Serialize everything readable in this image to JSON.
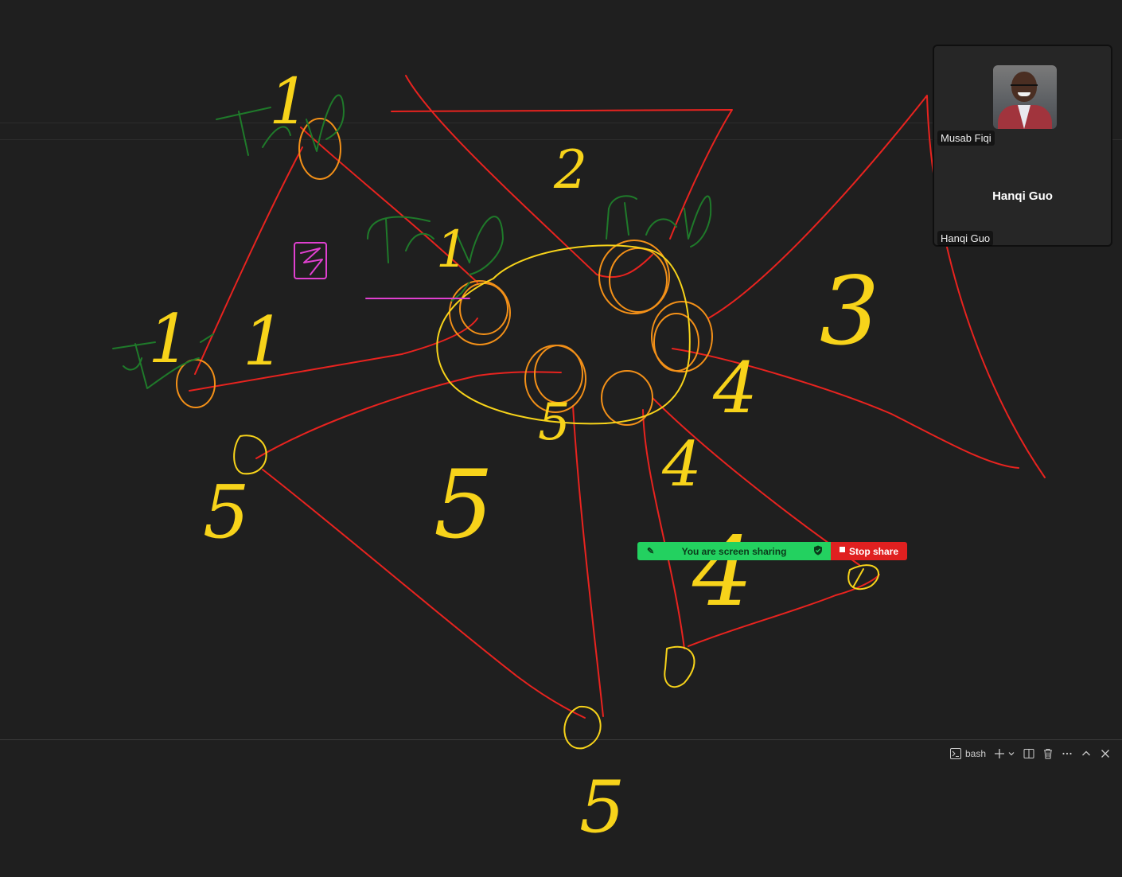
{
  "participants": {
    "video_tile": {
      "name": "Musab Fiqi"
    },
    "audio_tile": {
      "display_name": "Hanqi Guo",
      "name_tag": "Hanqi Guo"
    }
  },
  "sharing_bar": {
    "status_text": "You are screen sharing",
    "stop_label": "Stop share",
    "status_color": "#23d160",
    "stop_color": "#e02020"
  },
  "terminal_toolbar": {
    "profile_label": "bash",
    "icons": [
      "terminal-icon",
      "plus-icon",
      "chevron-down-icon",
      "split-terminal-icon",
      "trash-icon",
      "more-icon",
      "chevron-up-icon",
      "close-icon"
    ]
  },
  "annotations": {
    "pen_colors": {
      "red": "#e8231f",
      "yellow": "#f7d31a",
      "orange": "#f39018",
      "green": "#1f7a2a",
      "pink": "#e040d0"
    },
    "labels": [
      "1",
      "1",
      "1",
      "1",
      "2",
      "3",
      "4",
      "4",
      "4",
      "5",
      "5",
      "5",
      "Tri",
      "Tri",
      "Tri",
      "Tri",
      "0",
      "0",
      "0",
      "0",
      "0",
      "0",
      "5"
    ]
  }
}
